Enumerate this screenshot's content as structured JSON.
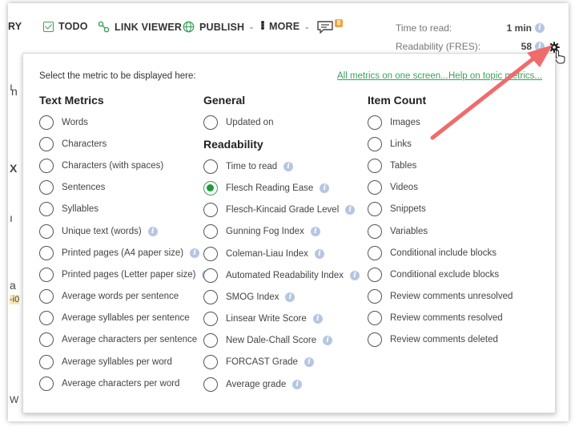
{
  "toolbar": {
    "history_partial": "RY",
    "todo": "TODO",
    "link_viewer": "LINK VIEWER",
    "publish": "PUBLISH",
    "more": "MORE",
    "comment_count": "8",
    "caret": "⌄"
  },
  "stats": {
    "time_to_read_label": "Time to read:",
    "time_to_read_value": "1 min",
    "readability_label": "Readability (FRES):",
    "readability_value": "58"
  },
  "bleed_chars": [
    "ı",
    "n",
    "X",
    "ı",
    "a",
    "-i0",
    "W"
  ],
  "panel": {
    "prompt": "Select the metric to be displayed here:",
    "link_all": "All metrics on one screen...",
    "link_help": "Help on topic metrics..."
  },
  "columns": {
    "text_metrics": {
      "title": "Text Metrics",
      "items": [
        {
          "label": "Words",
          "info": false
        },
        {
          "label": "Characters",
          "info": false
        },
        {
          "label": "Characters (with spaces)",
          "info": false
        },
        {
          "label": "Sentences",
          "info": false
        },
        {
          "label": "Syllables",
          "info": false
        },
        {
          "label": "Unique text (words)",
          "info": true
        },
        {
          "label": "Printed pages (A4 paper size)",
          "info": true
        },
        {
          "label": "Printed pages (Letter paper size)",
          "info": true
        },
        {
          "label": "Average words per sentence",
          "info": false
        },
        {
          "label": "Average syllables per sentence",
          "info": false
        },
        {
          "label": "Average characters per sentence",
          "info": false
        },
        {
          "label": "Average syllables per word",
          "info": false
        },
        {
          "label": "Average characters per word",
          "info": false
        }
      ]
    },
    "general": {
      "title": "General",
      "items": [
        {
          "label": "Updated on",
          "info": false
        }
      ]
    },
    "readability": {
      "title": "Readability",
      "selected": "Flesch Reading Ease",
      "items": [
        {
          "label": "Time to read",
          "info": true
        },
        {
          "label": "Flesch Reading Ease",
          "info": true
        },
        {
          "label": "Flesch-Kincaid Grade Level",
          "info": true
        },
        {
          "label": "Gunning Fog Index",
          "info": true
        },
        {
          "label": "Coleman-Liau Index",
          "info": true
        },
        {
          "label": "Automated Readability Index",
          "info": true
        },
        {
          "label": "SMOG Index",
          "info": true
        },
        {
          "label": "Linsear Write Score",
          "info": true
        },
        {
          "label": "New Dale-Chall Score",
          "info": true
        },
        {
          "label": "FORCAST Grade",
          "info": true
        },
        {
          "label": "Average grade",
          "info": true
        }
      ]
    },
    "item_count": {
      "title": "Item Count",
      "items": [
        {
          "label": "Images",
          "info": false
        },
        {
          "label": "Links",
          "info": false
        },
        {
          "label": "Tables",
          "info": false
        },
        {
          "label": "Videos",
          "info": false
        },
        {
          "label": "Snippets",
          "info": false
        },
        {
          "label": "Variables",
          "info": false
        },
        {
          "label": "Conditional include blocks",
          "info": false
        },
        {
          "label": "Conditional exclude blocks",
          "info": false
        },
        {
          "label": "Review comments unresolved",
          "info": false
        },
        {
          "label": "Review comments resolved",
          "info": false
        },
        {
          "label": "Review comments deleted",
          "info": false
        }
      ]
    }
  },
  "colors": {
    "accent_green": "#3aa15c",
    "badge_orange": "#f2a23a",
    "arrow_red": "#f06b6b",
    "info_blue": "#b6c6e2"
  },
  "icons": {
    "info": "i"
  }
}
